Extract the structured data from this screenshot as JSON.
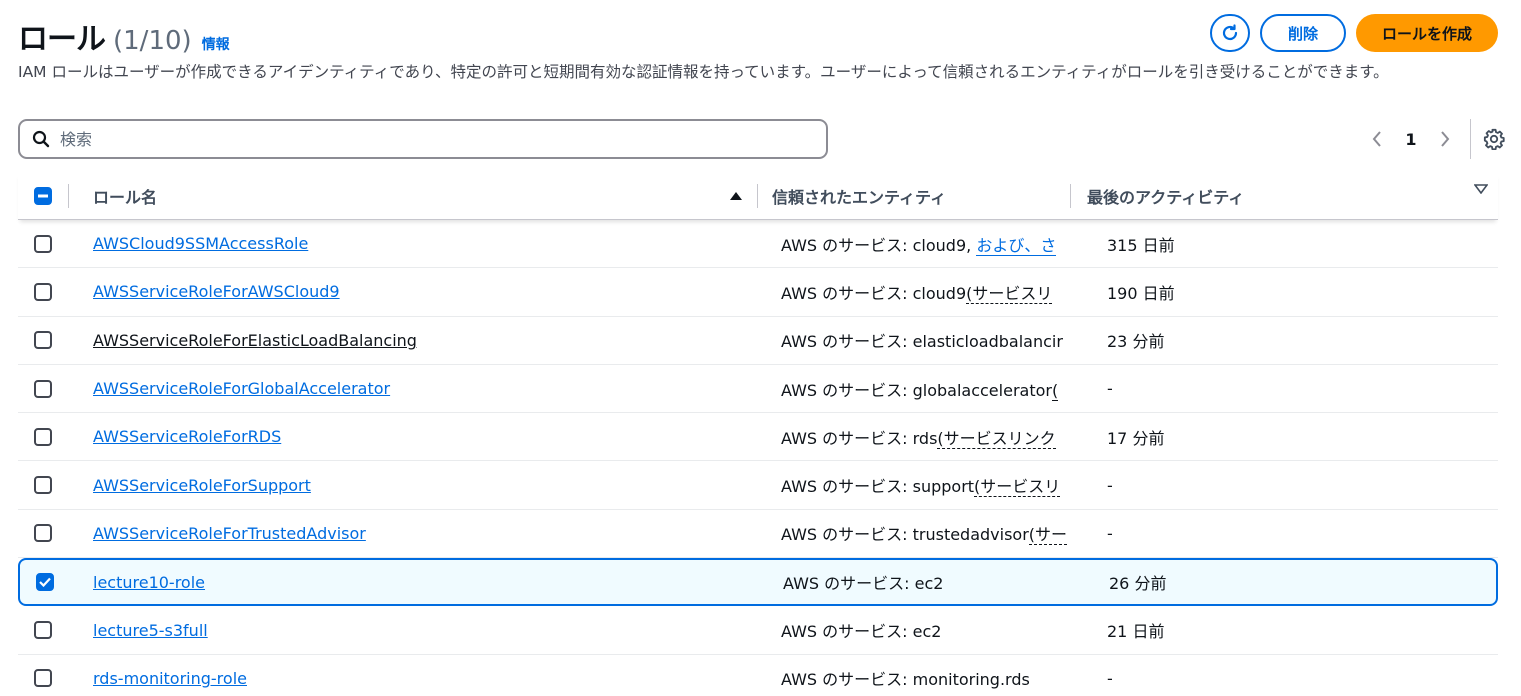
{
  "header": {
    "title": "ロール",
    "count": "(1/10)",
    "info_label": "情報",
    "delete_label": "削除",
    "create_label": "ロールを作成",
    "description": "IAM ロールはユーザーが作成できるアイデンティティであり、特定の許可と短期間有効な認証情報を持っています。ユーザーによって信頼されるエンティティがロールを引き受けることができます。"
  },
  "search": {
    "placeholder": "検索",
    "value": ""
  },
  "pagination": {
    "current_page": "1"
  },
  "table": {
    "columns": {
      "name": "ロール名",
      "trusted": "信頼されたエンティティ",
      "activity": "最後のアクティビティ"
    },
    "rows": [
      {
        "name": "AWSCloud9SSMAccessRole",
        "trust_prefix": "AWS のサービス: cloud9,",
        "trust_extra": "および、さ",
        "activity": "315 日前",
        "checked": false
      },
      {
        "name": "AWSServiceRoleForAWSCloud9",
        "trust_prefix": "AWS のサービス: cloud9",
        "trust_extra": "(サービスリ",
        "activity": "190 日前",
        "checked": false
      },
      {
        "name": "AWSServiceRoleForElasticLoadBalancing",
        "trust_prefix": "AWS のサービス: elasticloadbalancir",
        "trust_extra": "",
        "activity": "23 分前",
        "checked": false
      },
      {
        "name": "AWSServiceRoleForGlobalAccelerator",
        "trust_prefix": "AWS のサービス: globalaccelerator",
        "trust_extra": "(",
        "activity": "-",
        "checked": false
      },
      {
        "name": "AWSServiceRoleForRDS",
        "trust_prefix": "AWS のサービス: rds",
        "trust_extra": "(サービスリンク",
        "activity": "17 分前",
        "checked": false
      },
      {
        "name": "AWSServiceRoleForSupport",
        "trust_prefix": "AWS のサービス: support",
        "trust_extra": "(サービスリ",
        "activity": "-",
        "checked": false
      },
      {
        "name": "AWSServiceRoleForTrustedAdvisor",
        "trust_prefix": "AWS のサービス: trustedadvisor",
        "trust_extra": "(サー",
        "activity": "-",
        "checked": false
      },
      {
        "name": "lecture10-role",
        "trust_prefix": "AWS のサービス: ec2",
        "trust_extra": "",
        "activity": "26 分前",
        "checked": true
      },
      {
        "name": "lecture5-s3full",
        "trust_prefix": "AWS のサービス: ec2",
        "trust_extra": "",
        "activity": "21 日前",
        "checked": false
      },
      {
        "name": "rds-monitoring-role",
        "trust_prefix": "AWS のサービス: monitoring.rds",
        "trust_extra": "",
        "activity": "-",
        "checked": false
      }
    ]
  },
  "colors": {
    "accent": "#006ce0",
    "primary_button": "#ff9900",
    "selected_row_bg": "#f0fbff"
  }
}
